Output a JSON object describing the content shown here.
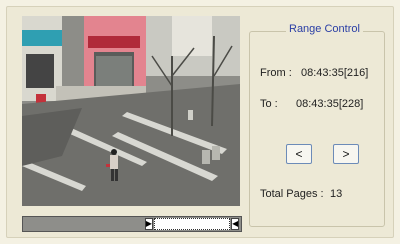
{
  "range_control": {
    "title": "Range Control",
    "from_label": "From :",
    "from_value": "08:43:35[216]",
    "to_label": "To :",
    "to_value": "08:43:35[228]",
    "prev_label": "<",
    "next_label": ">",
    "total_pages_label": "Total Pages :",
    "total_pages_value": "13"
  },
  "timeline": {
    "window_start_fraction": 0.6,
    "window_end_fraction": 0.95,
    "left_handle_icon": "play-right-icon",
    "right_handle_icon": "play-left-icon"
  },
  "video": {
    "description_icon": "camera-feed"
  },
  "colors": {
    "title_color": "#2a3ea5",
    "background": "#ede9d6",
    "button_border": "#6c8bb8"
  }
}
